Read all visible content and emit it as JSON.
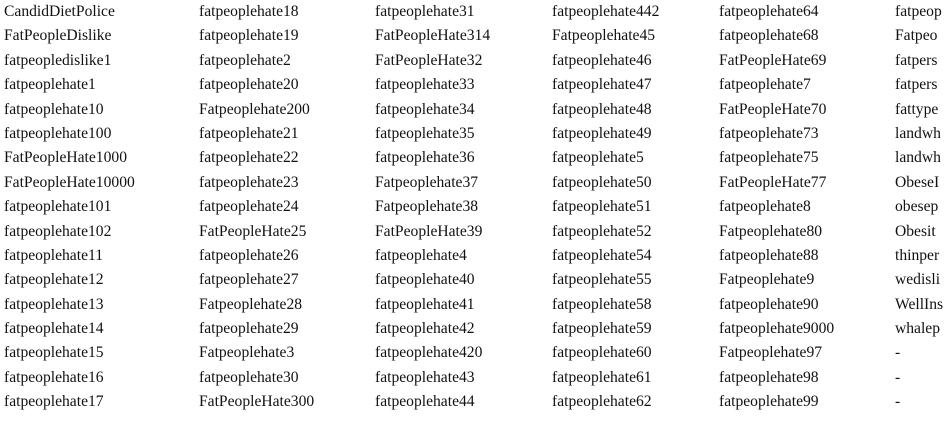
{
  "columns": [
    [
      "CandidDietPolice",
      "FatPeopleDislike",
      "fatpeopledislike1",
      "fatpeoplehate1",
      "fatpeoplehate10",
      "fatpeoplehate100",
      "FatPeopleHate1000",
      "FatPeopleHate10000",
      "fatpeoplehate101",
      "fatpeoplehate102",
      "fatpeoplehate11",
      "fatpeoplehate12",
      "fatpeoplehate13",
      "fatpeoplehate14",
      "fatpeoplehate15",
      "fatpeoplehate16",
      "fatpeoplehate17"
    ],
    [
      "fatpeoplehate18",
      "fatpeoplehate19",
      "fatpeoplehate2",
      "fatpeoplehate20",
      "Fatpeoplehate200",
      "fatpeoplehate21",
      "fatpeoplehate22",
      "fatpeoplehate23",
      "fatpeoplehate24",
      "FatPeopleHate25",
      "fatpeoplehate26",
      "fatpeoplehate27",
      "Fatpeoplehate28",
      "fatpeoplehate29",
      "Fatpeoplehate3",
      "fatpeoplehate30",
      "FatPeopleHate300"
    ],
    [
      "fatpeoplehate31",
      "FatPeopleHate314",
      "FatPeopleHate32",
      "fatpeoplehate33",
      "fatpeoplehate34",
      "fatpeoplehate35",
      "fatpeoplehate36",
      "Fatpeoplehate37",
      "Fatpeoplehate38",
      "FatPeopleHate39",
      "fatpeoplehate4",
      "fatpeoplehate40",
      "fatpeoplehate41",
      "fatpeoplehate42",
      "fatpeoplehate420",
      "fatpeoplehate43",
      "fatpeoplehate44"
    ],
    [
      "fatpeoplehate442",
      "Fatpeoplehate45",
      "fatpeoplehate46",
      "fatpeoplehate47",
      "fatpeoplehate48",
      "fatpeoplehate49",
      "fatpeoplehate5",
      "fatpeoplehate50",
      "fatpeoplehate51",
      "fatpeoplehate52",
      "fatpeoplehate54",
      "fatpeoplehate55",
      "fatpeoplehate58",
      "fatpeoplehate59",
      "fatpeoplehate60",
      "fatpeoplehate61",
      "fatpeoplehate62"
    ],
    [
      "fatpeoplehate64",
      "fatpeoplehate68",
      "FatPeopleHate69",
      "fatpeoplehate7",
      "FatPeopleHate70",
      "fatpeoplehate73",
      "fatpeoplehate75",
      "FatPeopleHate77",
      "fatpeoplehate8",
      "Fatpeoplehate80",
      "fatpeoplehate88",
      "Fatpeoplehate9",
      "fatpeoplehate90",
      "fatpeoplehate9000",
      "Fatpeoplehate97",
      "fatpeoplehate98",
      "fatpeoplehate99"
    ],
    [
      "fatpeop",
      "Fatpeo",
      "fatpers",
      "fatpers",
      "fattype",
      "landwh",
      "landwh",
      "ObeseI",
      "obesep",
      "Obesit",
      "thinper",
      "wedisli",
      "WellIns",
      "whalep",
      "-",
      "-",
      "-"
    ]
  ]
}
